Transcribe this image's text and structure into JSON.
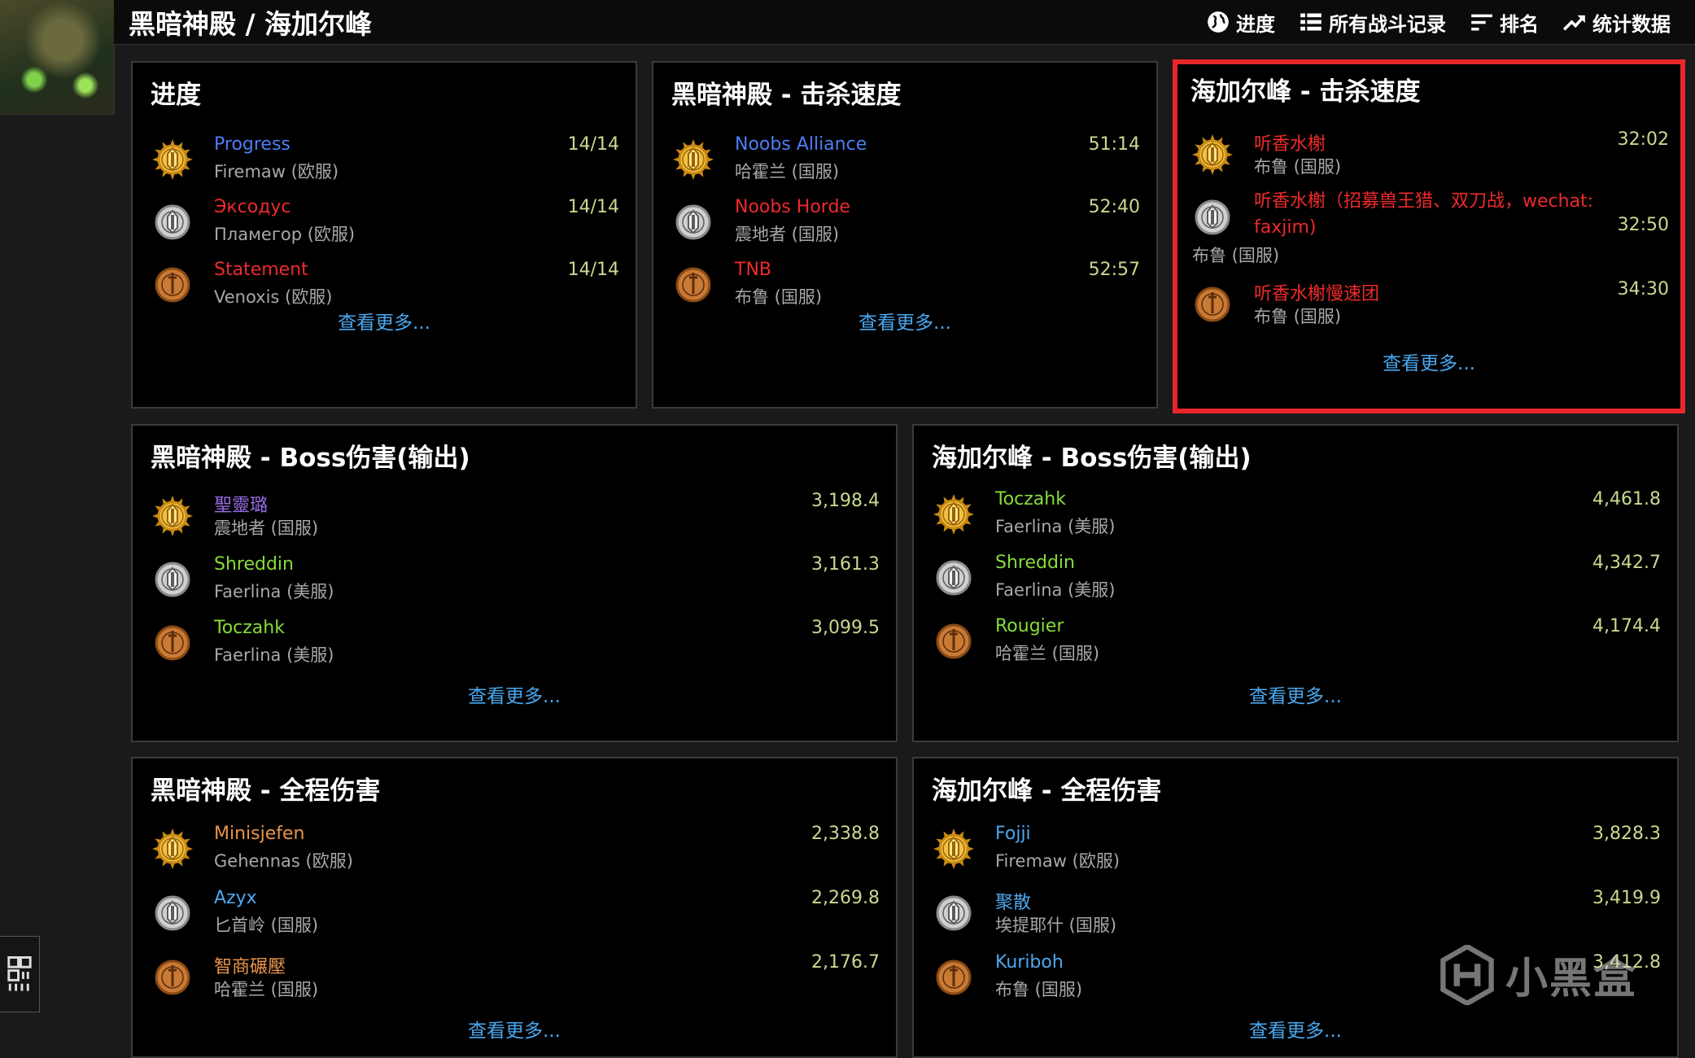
{
  "breadcrumb": "黑暗神殿 / 海加尔峰",
  "nav": [
    {
      "label": "进度",
      "icon": "globe-icon"
    },
    {
      "label": "所有战斗记录",
      "icon": "list-icon"
    },
    {
      "label": "排名",
      "icon": "sort-icon"
    },
    {
      "label": "统计数据",
      "icon": "trend-icon"
    }
  ],
  "panels": [
    {
      "title": "进度",
      "more": "查看更多...",
      "rows": [
        {
          "name": "Progress",
          "server": "Firemaw (欧服)",
          "value": "14/14",
          "medal": "gold",
          "color": "#4d7ef2"
        },
        {
          "name": "Эксодус",
          "server": "Пламегор (欧服)",
          "value": "14/14",
          "medal": "silver",
          "color": "#ee2a2a"
        },
        {
          "name": "Statement",
          "server": "Venoxis (欧服)",
          "value": "14/14",
          "medal": "bronze",
          "color": "#ee2a2a"
        }
      ]
    },
    {
      "title": "黑暗神殿 - 击杀速度",
      "more": "查看更多...",
      "rows": [
        {
          "name": "Noobs Alliance",
          "server": "哈霍兰 (国服)",
          "value": "51:14",
          "medal": "gold",
          "color": "#4d7ef2"
        },
        {
          "name": "Noobs Horde",
          "server": "震地者 (国服)",
          "value": "52:40",
          "medal": "silver",
          "color": "#ee2a2a"
        },
        {
          "name": "TNB",
          "server": "布鲁 (国服)",
          "value": "52:57",
          "medal": "bronze",
          "color": "#ee2a2a"
        }
      ]
    },
    {
      "title": "海加尔峰 - 击杀速度",
      "more": "查看更多...",
      "rows": [
        {
          "name": "听香水榭",
          "server": "布鲁 (国服)",
          "value": "32:02",
          "medal": "gold",
          "color": "#ee2a2a"
        },
        {
          "name": "听香水榭（招募兽王猎、双刀战，wechat: faxjim)",
          "server": "布鲁 (国服)",
          "value": "32:50",
          "medal": "silver",
          "color": "#ee2a2a"
        },
        {
          "name": "听香水榭慢速团",
          "server": "布鲁 (国服)",
          "value": "34:30",
          "medal": "bronze",
          "color": "#ee2a2a"
        }
      ]
    },
    {
      "title": "黑暗神殿 - Boss伤害(输出)",
      "more": "查看更多...",
      "rows": [
        {
          "name": "聖靈璐",
          "server": "震地者 (国服)",
          "value": "3,198.4",
          "medal": "gold",
          "color": "#9a6ce8"
        },
        {
          "name": "Shreddin",
          "server": "Faerlina (美服)",
          "value": "3,161.3",
          "medal": "silver",
          "color": "#86dc3a"
        },
        {
          "name": "Toczahk",
          "server": "Faerlina (美服)",
          "value": "3,099.5",
          "medal": "bronze",
          "color": "#86dc3a"
        }
      ]
    },
    {
      "title": "海加尔峰 - Boss伤害(输出)",
      "more": "查看更多...",
      "rows": [
        {
          "name": "Toczahk",
          "server": "Faerlina (美服)",
          "value": "4,461.8",
          "medal": "gold",
          "color": "#86dc3a"
        },
        {
          "name": "Shreddin",
          "server": "Faerlina (美服)",
          "value": "4,342.7",
          "medal": "silver",
          "color": "#86dc3a"
        },
        {
          "name": "Rougier",
          "server": "哈霍兰 (国服)",
          "value": "4,174.4",
          "medal": "bronze",
          "color": "#86dc3a"
        }
      ]
    },
    {
      "title": "黑暗神殿 - 全程伤害",
      "more": "查看更多...",
      "rows": [
        {
          "name": "Minisjefen",
          "server": "Gehennas (欧服)",
          "value": "2,338.8",
          "medal": "gold",
          "color": "#e9954a"
        },
        {
          "name": "Azyx",
          "server": "匕首岭 (国服)",
          "value": "2,269.8",
          "medal": "silver",
          "color": "#4ea7ef"
        },
        {
          "name": "智商碾壓",
          "server": "哈霍兰 (国服)",
          "value": "2,176.7",
          "medal": "bronze",
          "color": "#e9954a"
        }
      ]
    },
    {
      "title": "海加尔峰 - 全程伤害",
      "more": "查看更多...",
      "rows": [
        {
          "name": "Fojji",
          "server": "Firemaw (欧服)",
          "value": "3,828.3",
          "medal": "gold",
          "color": "#4ea7ef"
        },
        {
          "name": "聚散",
          "server": "埃提耶什 (国服)",
          "value": "3,419.9",
          "medal": "silver",
          "color": "#4ea7ef"
        },
        {
          "name": "Kuriboh",
          "server": "布鲁 (国服)",
          "value": "3,412.8",
          "medal": "bronze",
          "color": "#4ea7ef"
        }
      ]
    }
  ],
  "watermark": "小黑盒"
}
